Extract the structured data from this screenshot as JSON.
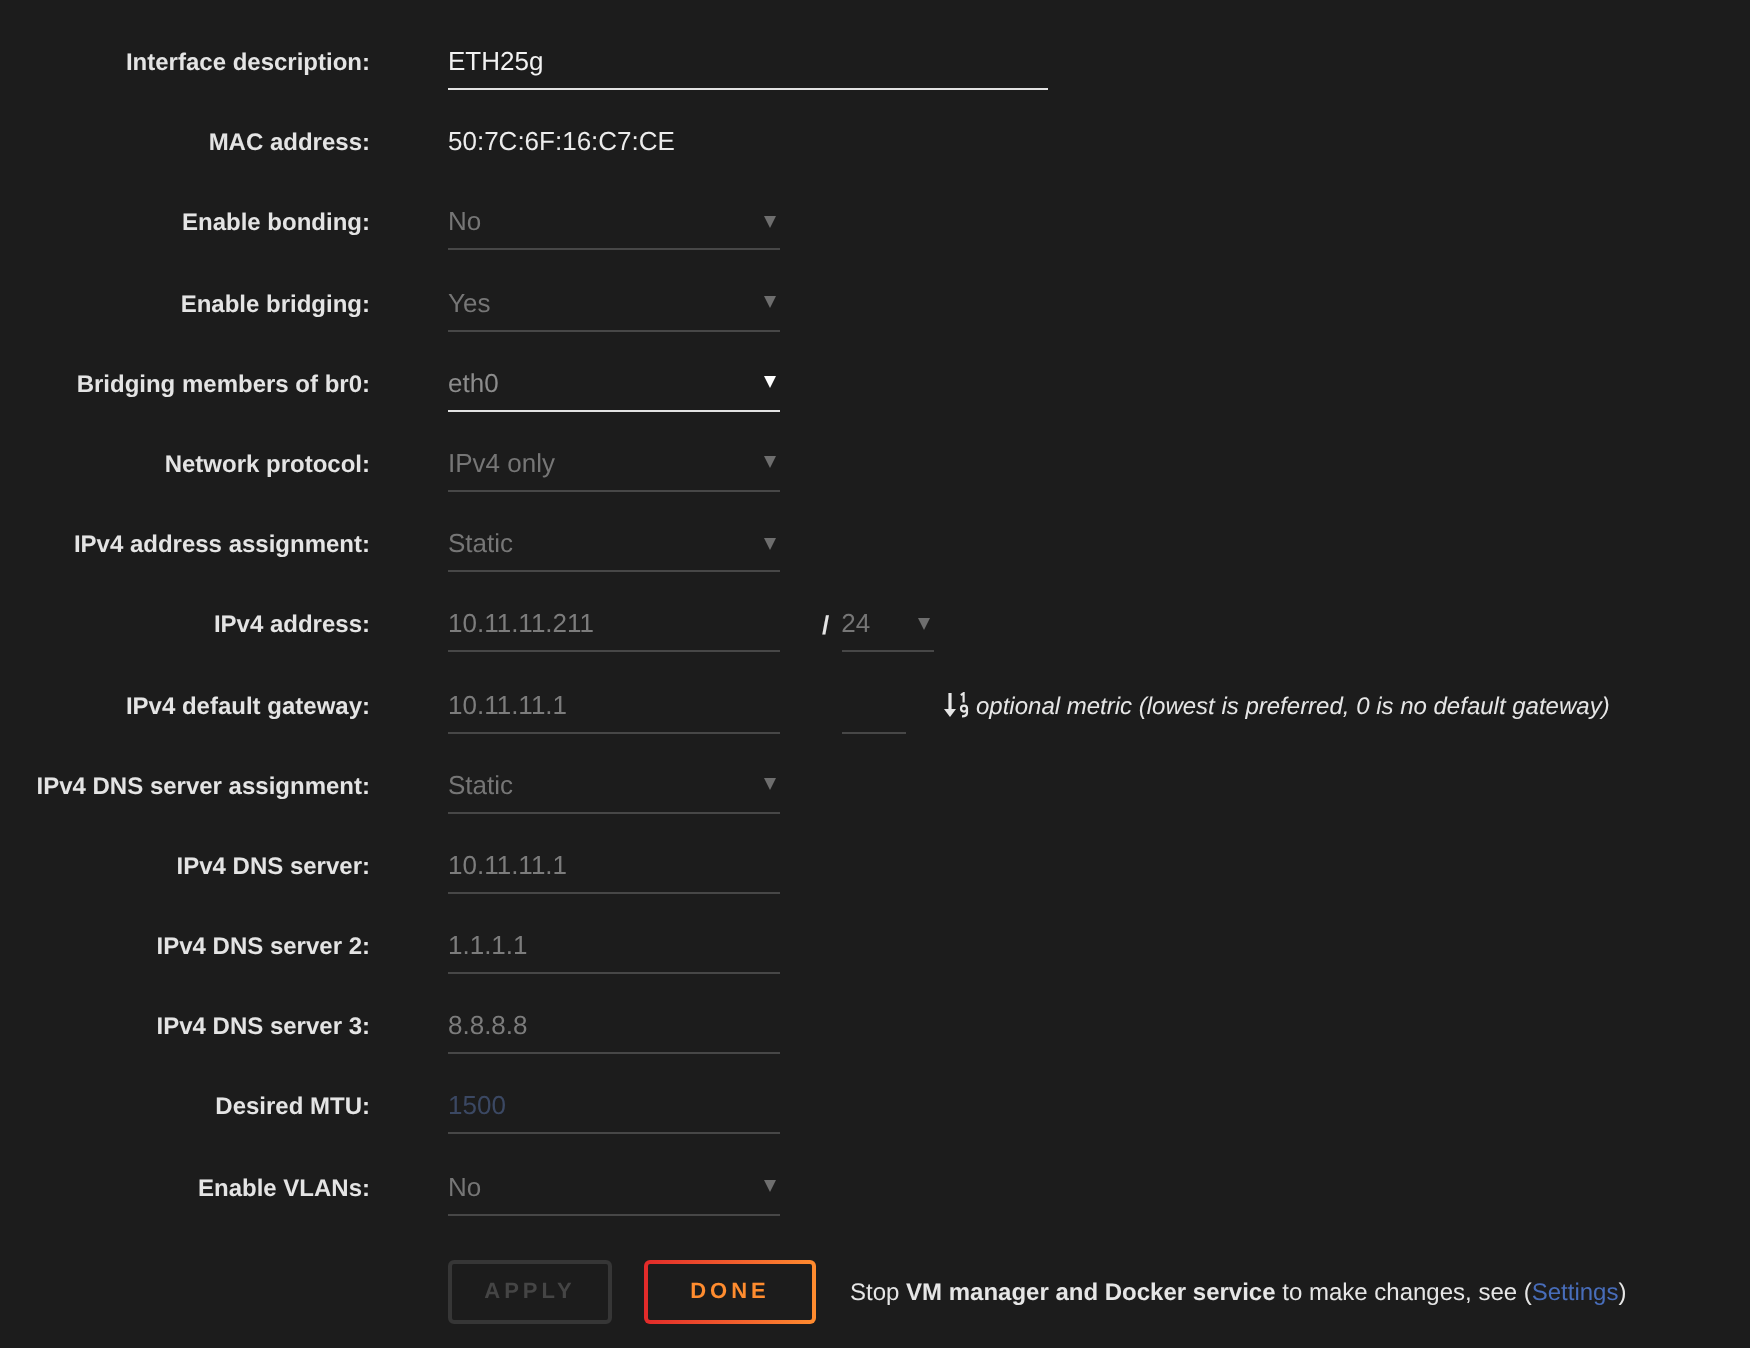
{
  "form": {
    "rows": [
      {
        "label": "Interface description:",
        "field": {
          "kind": "input",
          "value": "ETH25g",
          "disabled": false
        }
      },
      {
        "label": "MAC address:",
        "field": {
          "kind": "text",
          "value": "50:7C:6F:16:C7:CE"
        }
      },
      {
        "label": "Enable bonding:",
        "field": {
          "kind": "select",
          "value": "No",
          "disabled": true
        }
      },
      {
        "label": "Enable bridging:",
        "field": {
          "kind": "select",
          "value": "Yes",
          "disabled": true
        }
      },
      {
        "label": "Bridging members of br0:",
        "field": {
          "kind": "select",
          "value": "eth0",
          "disabled": false
        }
      },
      {
        "label": "Network protocol:",
        "field": {
          "kind": "select",
          "value": "IPv4 only",
          "disabled": true
        }
      },
      {
        "label": "IPv4 address assignment:",
        "field": {
          "kind": "select",
          "value": "Static",
          "disabled": true
        }
      },
      {
        "label": "IPv4 address:",
        "field": {
          "kind": "input",
          "value": "10.11.11.211",
          "disabled": true
        },
        "suffix": {
          "kind": "netmask",
          "separator": "/",
          "value": "24",
          "disabled": true
        }
      },
      {
        "label": "IPv4 default gateway:",
        "field": {
          "kind": "input",
          "value": "10.11.11.1",
          "disabled": true
        },
        "suffix": {
          "kind": "metric",
          "disabled": true,
          "hint": "optional metric (lowest is preferred, 0 is no default gateway)"
        }
      },
      {
        "label": "IPv4 DNS server assignment:",
        "field": {
          "kind": "select",
          "value": "Static",
          "disabled": true
        }
      },
      {
        "label": "IPv4 DNS server:",
        "field": {
          "kind": "input",
          "value": "10.11.11.1",
          "disabled": true
        }
      },
      {
        "label": "IPv4 DNS server 2:",
        "field": {
          "kind": "input",
          "value": "1.1.1.1",
          "disabled": true
        }
      },
      {
        "label": "IPv4 DNS server 3:",
        "field": {
          "kind": "input",
          "value": "8.8.8.8",
          "disabled": true
        }
      },
      {
        "label": "Desired MTU:",
        "field": {
          "kind": "input",
          "placeholder": "1500",
          "disabled": true
        }
      },
      {
        "label": "Enable VLANs:",
        "field": {
          "kind": "select",
          "value": "No",
          "disabled": true
        }
      }
    ]
  },
  "buttons": [
    {
      "label": "APPLY",
      "disabled": true
    },
    {
      "label": "DONE",
      "disabled": false
    }
  ],
  "note": {
    "text": "Stop **VM manager and Docker service** to make changes, see (",
    "link": "Settings",
    "after": ")"
  }
}
